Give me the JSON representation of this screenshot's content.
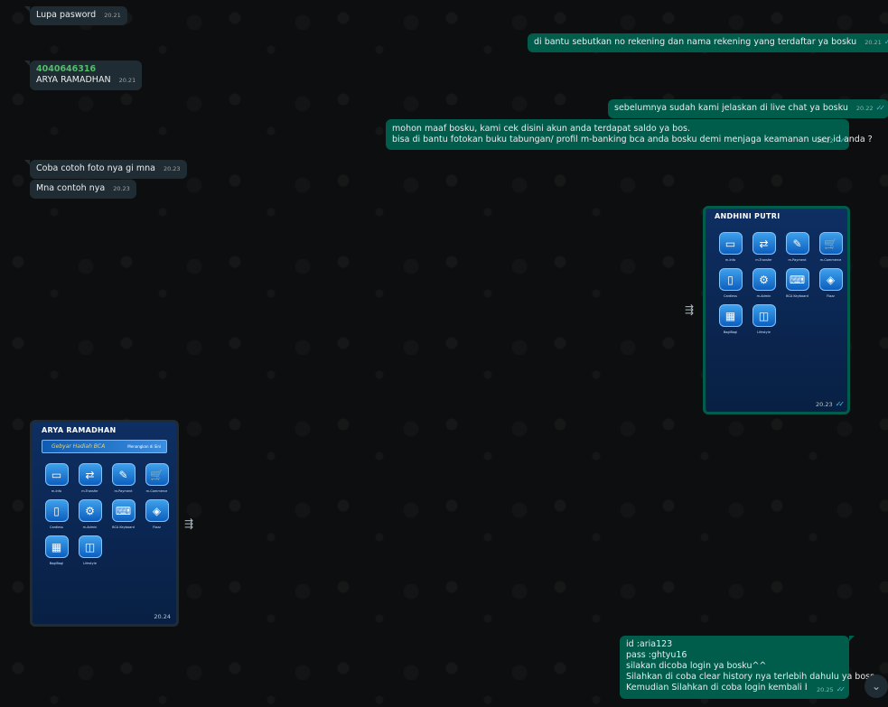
{
  "messages": [
    {
      "id": "m1",
      "text": "Lupa pasword",
      "time": "20.21"
    },
    {
      "id": "m2",
      "text": "di bantu sebutkan no rekening dan nama rekening yang terdaftar ya bosku",
      "time": "20.21"
    },
    {
      "id": "m3",
      "sender": "4040646316",
      "text": "ARYA RAMADHAN",
      "time": "20.21"
    },
    {
      "id": "m4",
      "text": "sebelumnya sudah kami jelaskan di live chat ya bosku",
      "time": "20.22"
    },
    {
      "id": "m5",
      "lines": [
        "mohon maaf bosku, kami cek disini akun anda terdapat saldo ya bos.",
        "bisa di bantu fotokan buku tabungan/ profil m-banking bca anda bosku demi menjaga keamanan user id anda ?"
      ],
      "time": "20.22"
    },
    {
      "id": "m6",
      "text": "Coba cotoh foto nya gi mna",
      "time": "20.23"
    },
    {
      "id": "m7",
      "text": "Mna contoh nya",
      "time": "20.23"
    },
    {
      "id": "m10",
      "lines": [
        "id :aria123",
        "pass :ghtyu16",
        "silakan dicoba login ya bosku^^",
        "Silahkan di coba clear history nya terlebih dahulu ya boss...",
        "Kemudian Silahkan di coba login kembali bosskuu.."
      ],
      "time": "20.25"
    }
  ],
  "image1": {
    "name": "ANDHINI PUTRI",
    "time": "20.23",
    "apps": [
      {
        "label": "m-Info",
        "icon": "card-icon"
      },
      {
        "label": "m-Transfer",
        "icon": "transfer-icon"
      },
      {
        "label": "m-Payment",
        "icon": "payment-icon"
      },
      {
        "label": "m-Commerce",
        "icon": "cart-icon"
      },
      {
        "label": "Cardless",
        "icon": "cardless-icon"
      },
      {
        "label": "m-Admin",
        "icon": "admin-icon"
      },
      {
        "label": "BCA Keyboard",
        "icon": "keyboard-icon"
      },
      {
        "label": "Flazz",
        "icon": "flazz-icon"
      },
      {
        "label": "BagiBagi",
        "icon": "bagibagi-icon"
      },
      {
        "label": "Lifestyle",
        "icon": "lifestyle-icon"
      }
    ]
  },
  "image2": {
    "name": "ARYA RAMADHAN",
    "time": "20.24",
    "banner_logo": "Gebyar Hadiah BCA",
    "banner_link": "Menangkan di Sini",
    "apps": [
      {
        "label": "m-Info",
        "icon": "card-icon"
      },
      {
        "label": "m-Transfer",
        "icon": "transfer-icon"
      },
      {
        "label": "m-Payment",
        "icon": "payment-icon"
      },
      {
        "label": "m-Commerce",
        "icon": "cart-icon"
      },
      {
        "label": "Cardless",
        "icon": "cardless-icon"
      },
      {
        "label": "m-Admin",
        "icon": "admin-icon"
      },
      {
        "label": "BCA Keyboard",
        "icon": "keyboard-icon"
      },
      {
        "label": "Flazz",
        "icon": "flazz-icon"
      },
      {
        "label": "BagiBagi",
        "icon": "bagibagi-icon"
      },
      {
        "label": "Lifestyle",
        "icon": "lifestyle-icon"
      }
    ]
  },
  "colors": {
    "incoming": "#202c33",
    "outgoing": "#005c4b",
    "read_ticks": "#53bdeb",
    "sender_name": "#53bd6b"
  }
}
